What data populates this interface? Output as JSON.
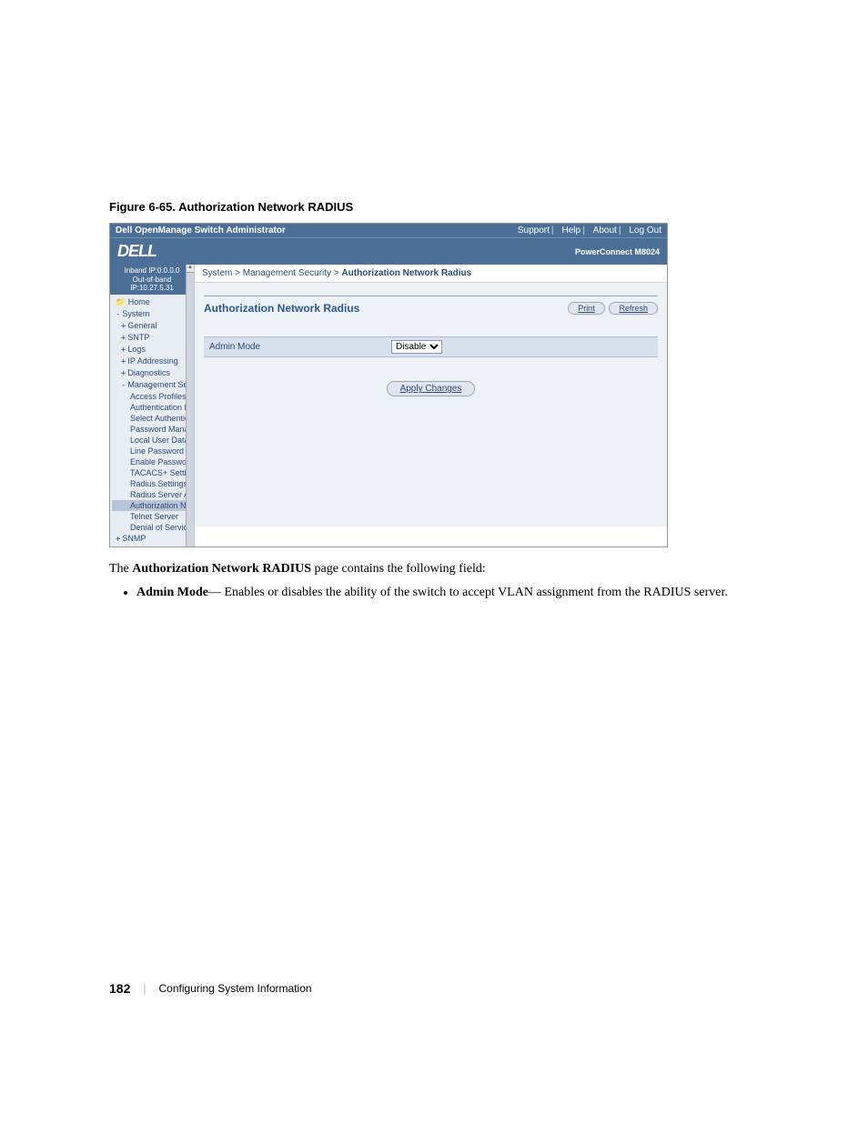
{
  "caption": "Figure 6-65.    Authorization Network RADIUS",
  "screenshot": {
    "window_title": "Dell OpenManage Switch Administrator",
    "top_links": [
      "Support",
      "Help",
      "About",
      "Log Out"
    ],
    "product": "PowerConnect M8024",
    "logo_text": "DELL",
    "ip_lines": [
      "Inband IP:0.0.0.0",
      "Out-of-band IP:10.27.5.31"
    ],
    "tree": {
      "home": "Home",
      "system": "System",
      "children": [
        {
          "label": "General",
          "exp": "+",
          "lvl": 1
        },
        {
          "label": "SNTP",
          "exp": "+",
          "lvl": 1
        },
        {
          "label": "Logs",
          "exp": "+",
          "lvl": 1
        },
        {
          "label": "IP Addressing",
          "exp": "+",
          "lvl": 1
        },
        {
          "label": "Diagnostics",
          "exp": "+",
          "lvl": 1
        },
        {
          "label": "Management Secur",
          "exp": "-",
          "lvl": 1
        },
        {
          "label": "Access Profiles",
          "lvl": 2
        },
        {
          "label": "Authentication P",
          "lvl": 2
        },
        {
          "label": "Select Authentic",
          "lvl": 2
        },
        {
          "label": "Password Manag",
          "lvl": 2
        },
        {
          "label": "Local User Datab",
          "lvl": 2
        },
        {
          "label": "Line Password",
          "lvl": 2
        },
        {
          "label": "Enable Password",
          "lvl": 2
        },
        {
          "label": "TACACS+ Settin",
          "lvl": 2
        },
        {
          "label": "Radius Settings",
          "lvl": 2
        },
        {
          "label": "Radius Server Ad",
          "lvl": 2
        },
        {
          "label": "Authorization N",
          "lvl": 2,
          "selected": true
        },
        {
          "label": "Telnet Server",
          "lvl": 2
        },
        {
          "label": "Denial of Service",
          "lvl": 2
        }
      ],
      "snmp": "SNMP"
    },
    "breadcrumb": {
      "a": "System",
      "b": "Management Security",
      "c": "Authorization Network Radius"
    },
    "panel_title": "Authorization Network Radius",
    "buttons": {
      "print": "Print",
      "refresh": "Refresh"
    },
    "field": {
      "label": "Admin Mode",
      "value": "Disable"
    },
    "apply": "Apply Changes"
  },
  "body": {
    "intro_pre": "The ",
    "intro_bold": "Authorization Network RADIUS",
    "intro_post": " page contains the following field:",
    "bullet_bold": "Admin Mode",
    "bullet_rest": "— Enables or disables the ability of the switch to accept VLAN assignment from the RADIUS server."
  },
  "footer": {
    "page": "182",
    "section": "Configuring System Information"
  }
}
